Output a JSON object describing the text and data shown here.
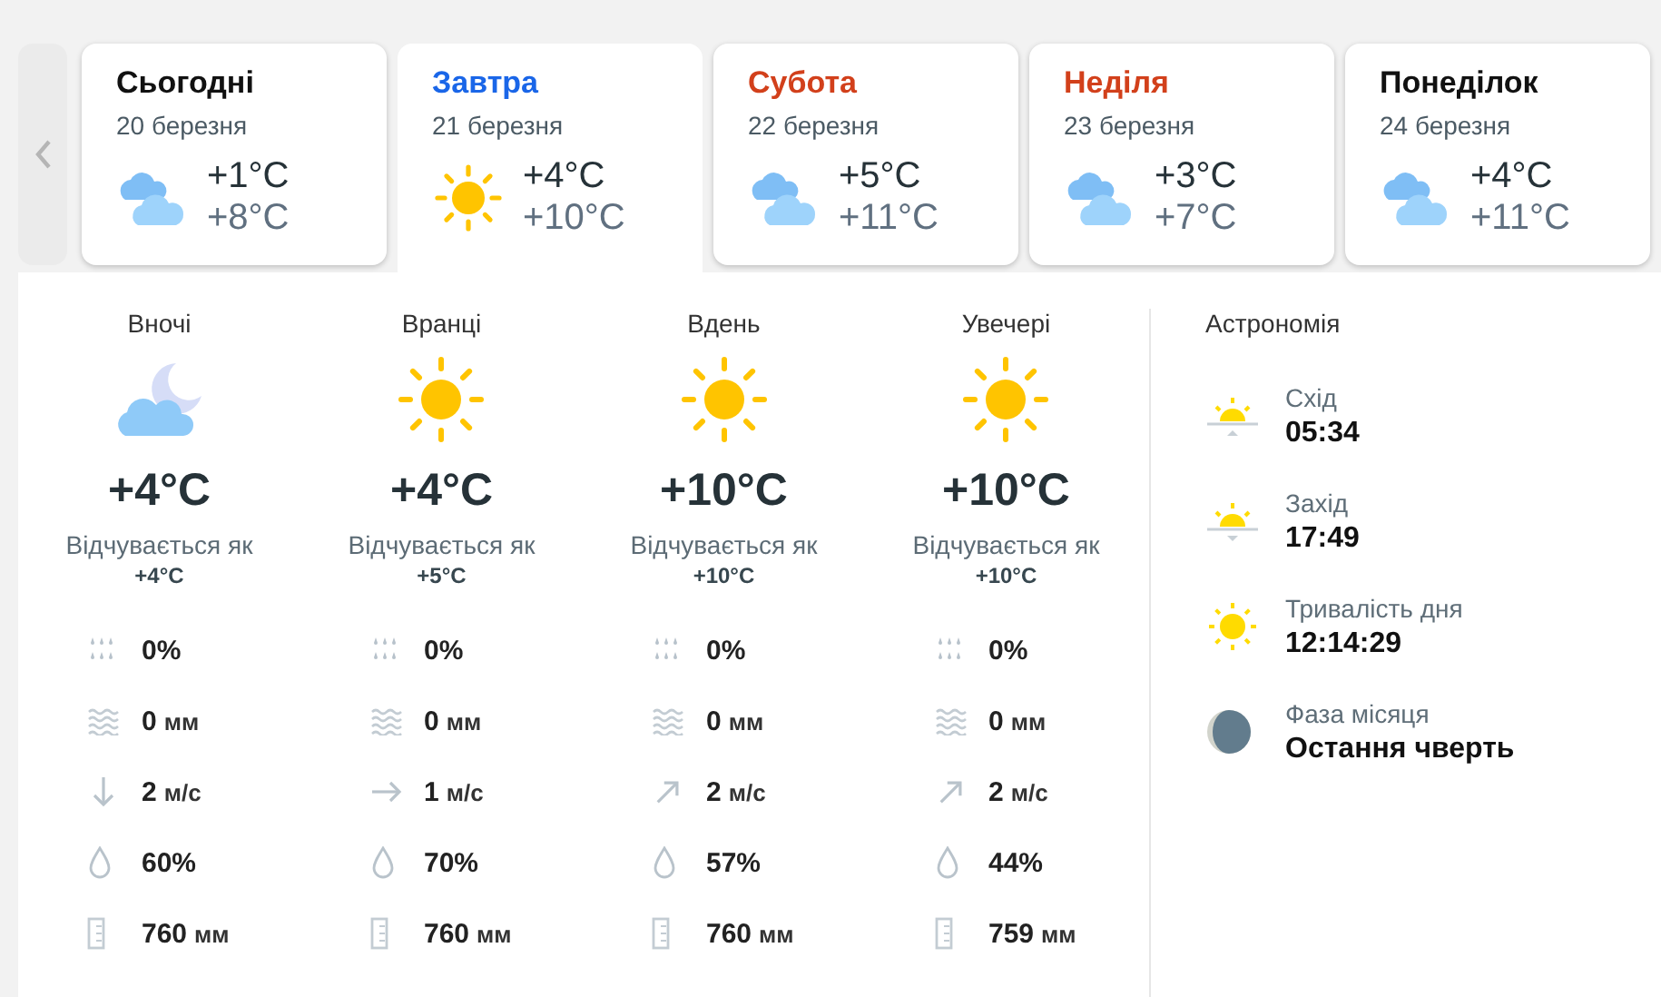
{
  "days": [
    {
      "name": "Сьогодні",
      "date": "20 березня",
      "color": "#111111",
      "selected": false,
      "kind": "cloudy",
      "min": "+1°C",
      "max": "+8°C"
    },
    {
      "name": "Завтра",
      "date": "21 березня",
      "color": "#1a66e8",
      "selected": true,
      "kind": "sunny",
      "min": "+4°C",
      "max": "+10°C"
    },
    {
      "name": "Субота",
      "date": "22 березня",
      "color": "#d2401b",
      "selected": false,
      "kind": "cloudy",
      "min": "+5°C",
      "max": "+11°C"
    },
    {
      "name": "Неділя",
      "date": "23 березня",
      "color": "#d2401b",
      "selected": false,
      "kind": "cloudy",
      "min": "+3°C",
      "max": "+7°C"
    },
    {
      "name": "Понеділок",
      "date": "24 березня",
      "color": "#111111",
      "selected": false,
      "kind": "cloudy",
      "min": "+4°C",
      "max": "+11°C"
    }
  ],
  "periods": [
    {
      "name": "Вночі",
      "kind": "night-cloudy",
      "temp": "+4°C",
      "feels_label": "Відчувається як",
      "feels": "+4°C",
      "stats": [
        {
          "kind": "precipitation",
          "value": "0%"
        },
        {
          "kind": "amount",
          "value": "0",
          "unit": "мм"
        },
        {
          "kind": "wind-down",
          "value": "2",
          "unit": "м/с"
        },
        {
          "kind": "humidity",
          "value": "60%"
        },
        {
          "kind": "pressure",
          "value": "760",
          "unit": "мм"
        }
      ]
    },
    {
      "name": "Вранці",
      "kind": "sunny",
      "temp": "+4°C",
      "feels_label": "Відчувається як",
      "feels": "+5°C",
      "stats": [
        {
          "kind": "precipitation",
          "value": "0%"
        },
        {
          "kind": "amount",
          "value": "0",
          "unit": "мм"
        },
        {
          "kind": "wind-right",
          "value": "1",
          "unit": "м/с"
        },
        {
          "kind": "humidity",
          "value": "70%"
        },
        {
          "kind": "pressure",
          "value": "760",
          "unit": "мм"
        }
      ]
    },
    {
      "name": "Вдень",
      "kind": "sunny",
      "temp": "+10°C",
      "feels_label": "Відчувається як",
      "feels": "+10°C",
      "stats": [
        {
          "kind": "precipitation",
          "value": "0%"
        },
        {
          "kind": "amount",
          "value": "0",
          "unit": "мм"
        },
        {
          "kind": "wind-upright",
          "value": "2",
          "unit": "м/с"
        },
        {
          "kind": "humidity",
          "value": "57%"
        },
        {
          "kind": "pressure",
          "value": "760",
          "unit": "мм"
        }
      ]
    },
    {
      "name": "Увечері",
      "kind": "sunny",
      "temp": "+10°C",
      "feels_label": "Відчувається як",
      "feels": "+10°C",
      "stats": [
        {
          "kind": "precipitation",
          "value": "0%"
        },
        {
          "kind": "amount",
          "value": "0",
          "unit": "мм"
        },
        {
          "kind": "wind-upright",
          "value": "2",
          "unit": "м/с"
        },
        {
          "kind": "humidity",
          "value": "44%"
        },
        {
          "kind": "pressure",
          "value": "759",
          "unit": "мм"
        }
      ]
    }
  ],
  "astronomy": {
    "title": "Астрономія",
    "items": [
      {
        "kind": "sunrise",
        "label": "Схід",
        "value": "05:34"
      },
      {
        "kind": "sunset",
        "label": "Захід",
        "value": "17:49"
      },
      {
        "kind": "daylength",
        "label": "Тривалість дня",
        "value": "12:14:29"
      },
      {
        "kind": "moon",
        "label": "Фаза місяця",
        "value": "Остання чверть"
      }
    ]
  }
}
